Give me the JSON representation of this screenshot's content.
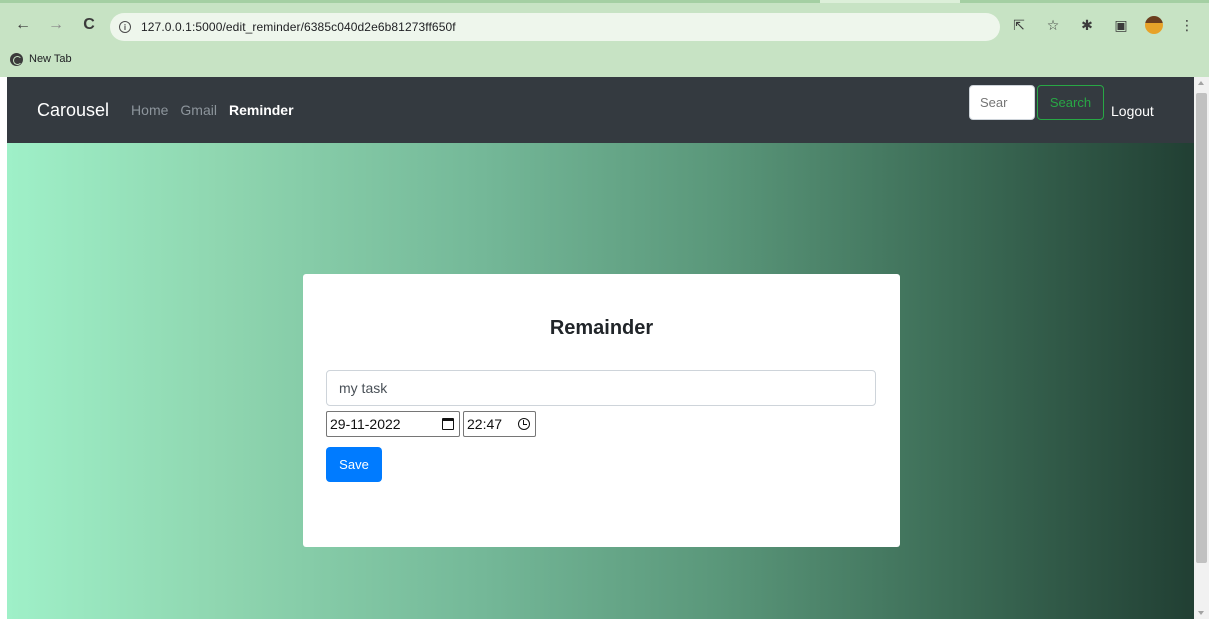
{
  "browser": {
    "url": "127.0.0.1:5000/edit_reminder/6385c040d2e6b81273ff650f",
    "bookmark": "New Tab",
    "icons": [
      "back-arrow-icon",
      "forward-arrow-icon",
      "reload-icon",
      "info-icon",
      "share-icon",
      "star-icon",
      "extensions-puzzle-icon",
      "sidepanel-icon",
      "profile-avatar",
      "kebab-menu-icon"
    ],
    "glyphs": {
      "back": "←",
      "forward": "→",
      "reload": "C",
      "info": "i",
      "share": "⇱",
      "star": "☆",
      "puzzle": "✱",
      "panel": "▣",
      "menu": "⋮"
    }
  },
  "navbar": {
    "brand": "Carousel",
    "links": [
      {
        "label": "Home",
        "active": false
      },
      {
        "label": "Gmail",
        "active": false
      },
      {
        "label": "Reminder",
        "active": true
      }
    ],
    "search_placeholder": "Sear",
    "search_button": "Search",
    "logout": "Logout"
  },
  "form": {
    "title": "Remainder",
    "task_value": "my task",
    "date_value": "29-11-2022",
    "time_value": "22:47",
    "save_label": "Save"
  },
  "colors": {
    "navbar_bg": "#343a40",
    "primary": "#007bff",
    "success": "#28a745",
    "gradient_start": "#9ff0c8",
    "gradient_end": "#213f33"
  }
}
